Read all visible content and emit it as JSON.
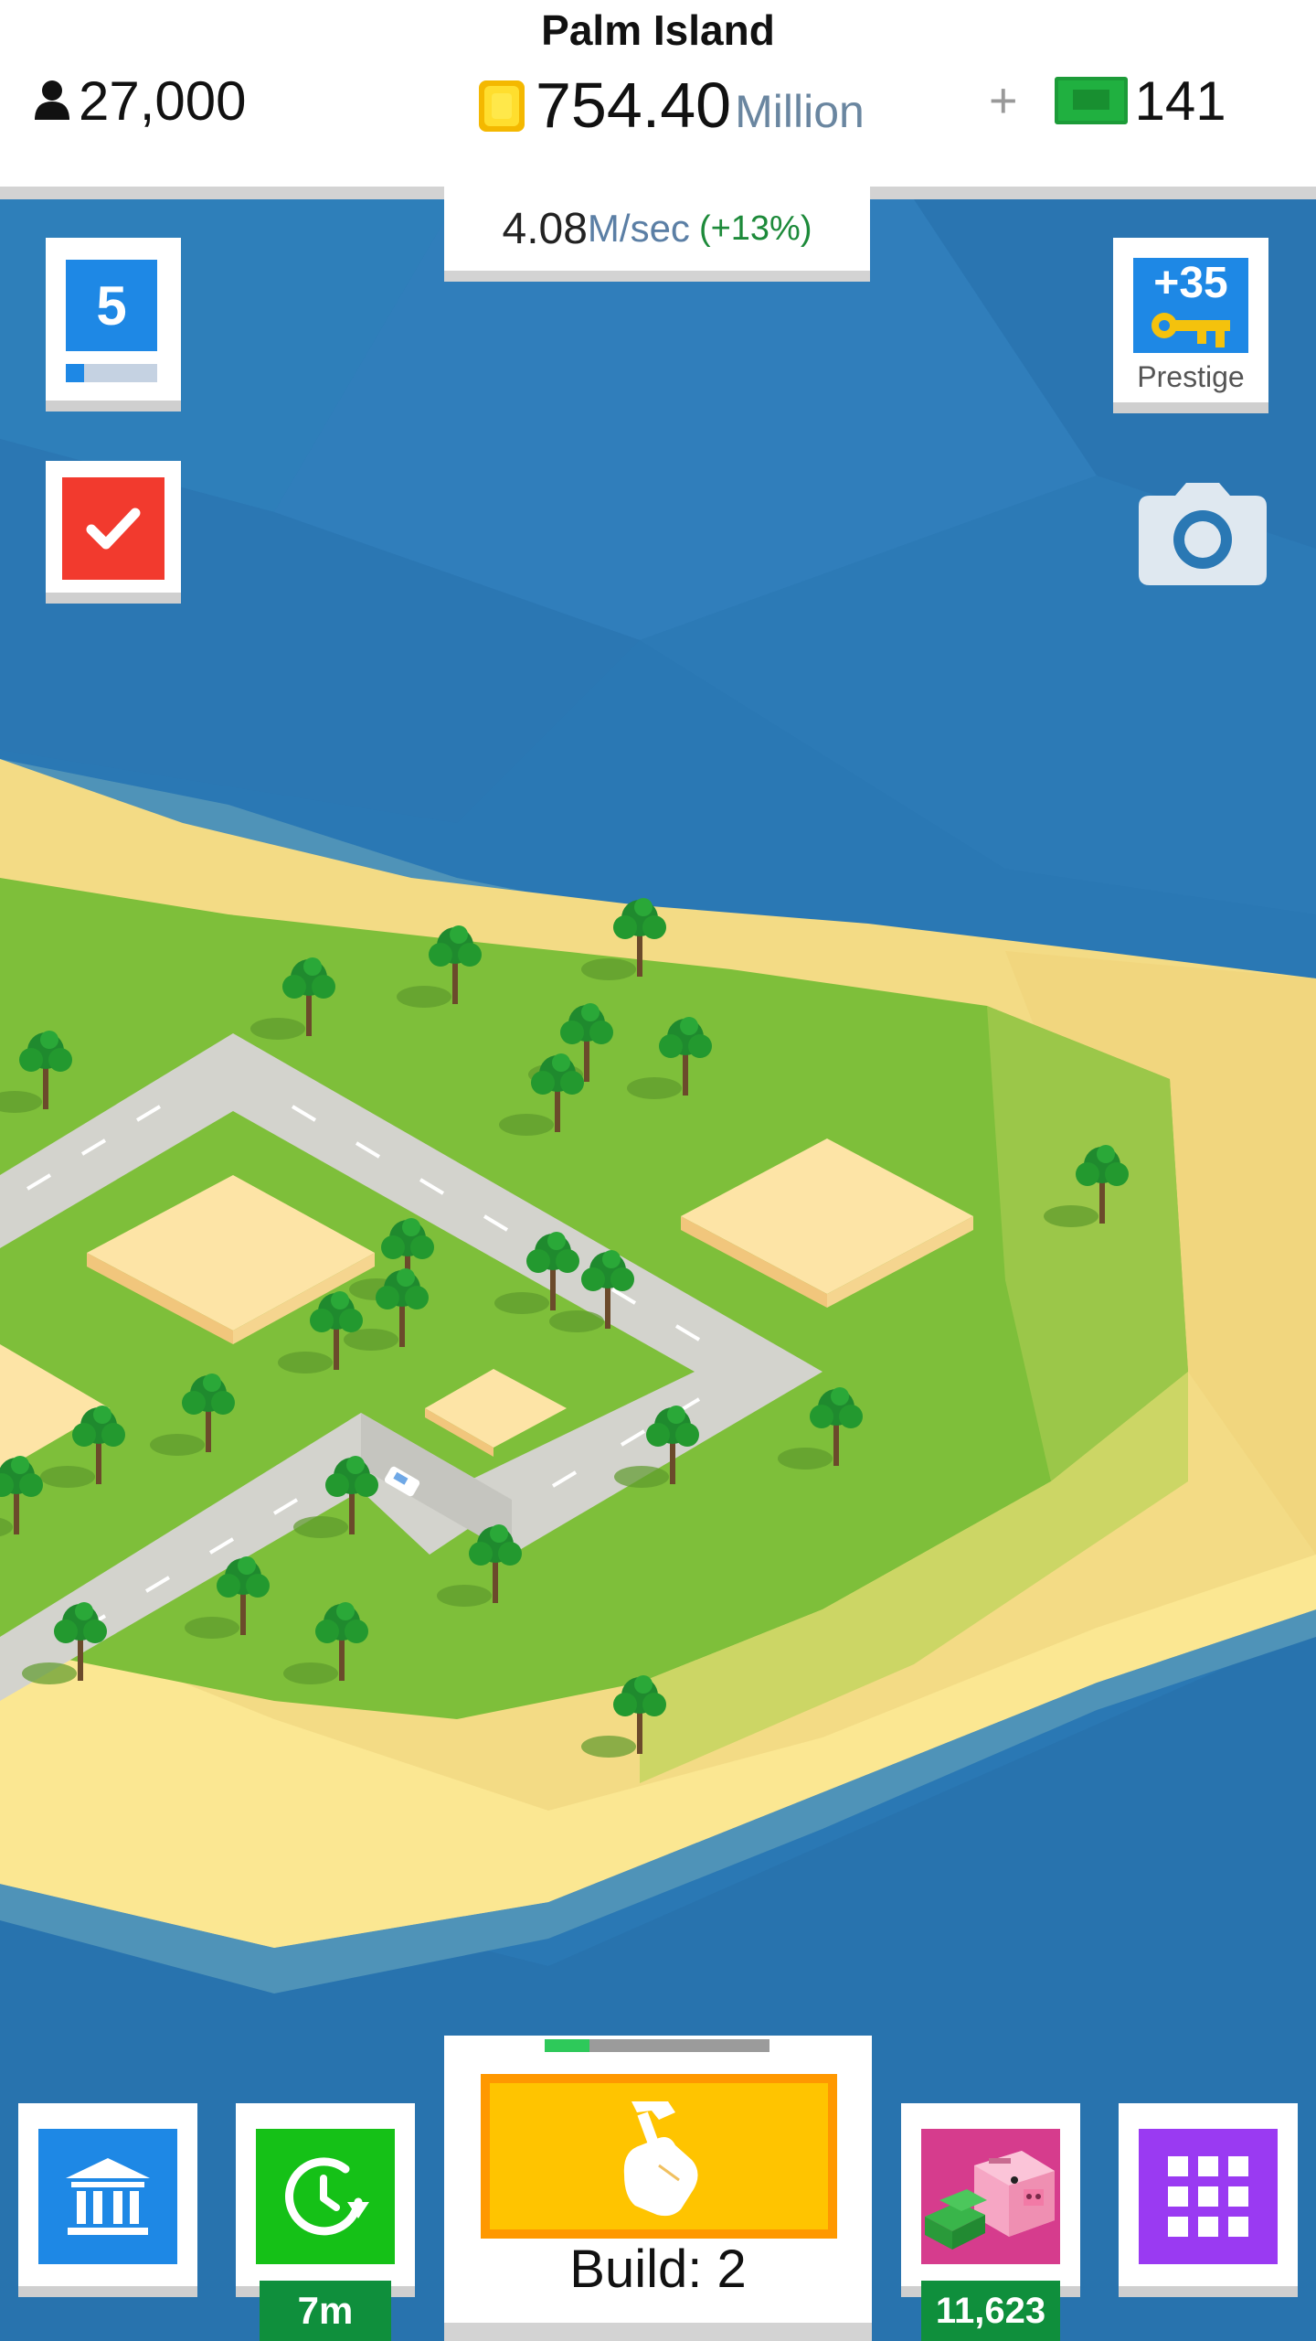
{
  "header": {
    "city_name": "Palm Island",
    "population": "27,000",
    "money_value": "754.40",
    "money_unit": "Million",
    "cash_plus": "+",
    "cash_value": "141",
    "rate_value": "4.08",
    "rate_unit": "M/sec",
    "rate_bonus": "(+13%)"
  },
  "side_buttons": {
    "level": "5",
    "level_progress": 0.2,
    "prestige_count": "+35",
    "prestige_label": "Prestige"
  },
  "bottom_bar": {
    "boost_timer": "7m",
    "build_label": "Build: 2",
    "build_progress": 0.2,
    "savings_count": "11,623"
  },
  "icons": [
    "person-icon",
    "coin-icon",
    "cash-icon",
    "checkmark-icon",
    "key-icon",
    "camera-icon",
    "bank-icon",
    "clock-refresh-icon",
    "build-hand-hammer-icon",
    "piggy-bank-icon",
    "grid-menu-icon"
  ],
  "colors": {
    "ocean": "#2a78b4",
    "grass": "#7ebf3a",
    "sand": "#f6e08a",
    "accent_blue": "#1e88e5",
    "build_yellow": "#ffc400",
    "boost_green": "#15c117",
    "menu_purple": "#9a3af2",
    "savings_pink": "#d63c8d",
    "tasks_red": "#f23a2e"
  }
}
